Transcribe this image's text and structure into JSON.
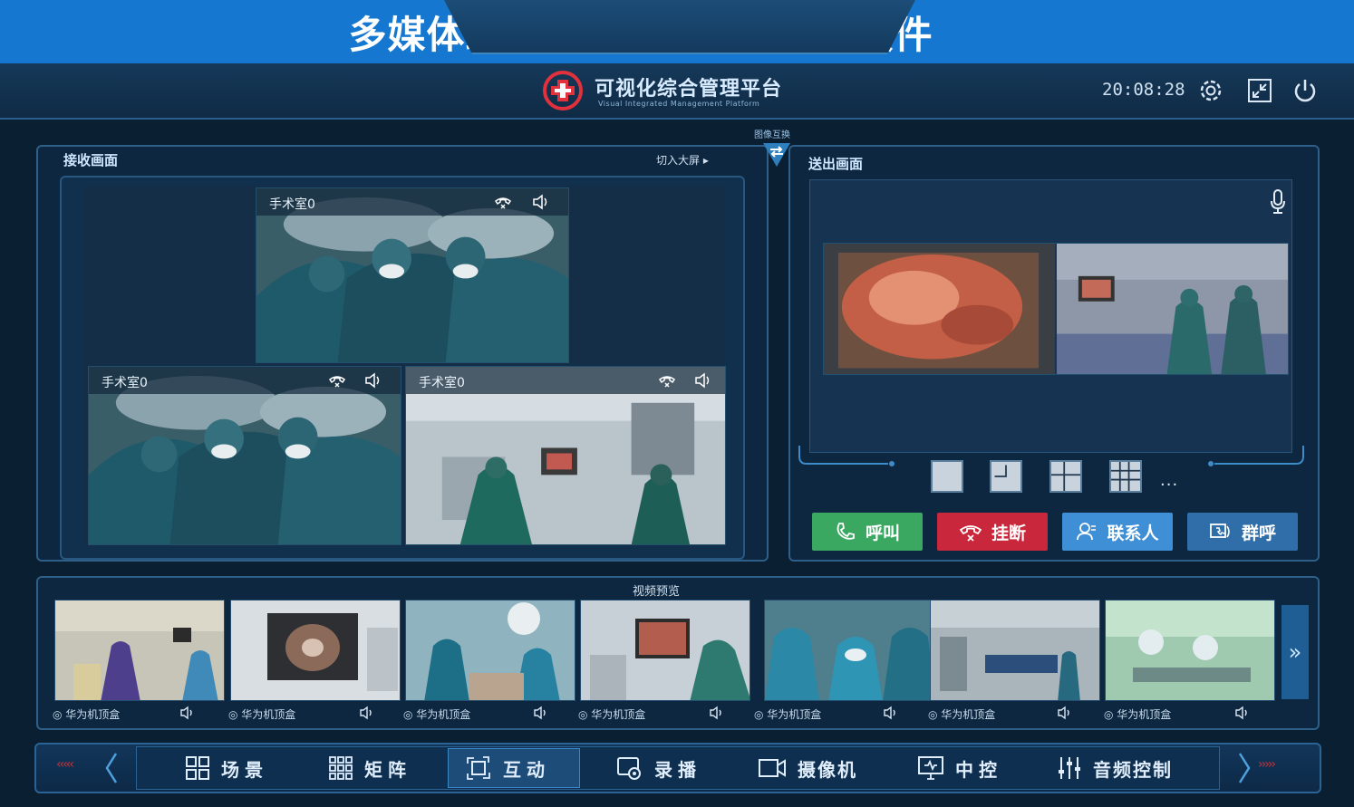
{
  "banner": {
    "title": "多媒体综合管理一体机—管理软件"
  },
  "header": {
    "platform_title": "可视化综合管理平台",
    "platform_subtitle": "Visual Integrated Management Platform",
    "time": "20:08:28",
    "icons": [
      "settings-icon",
      "exit-fullscreen-icon",
      "power-icon"
    ]
  },
  "receive": {
    "title": "接收画面",
    "big_screen": "切入大屏",
    "swap_label": "图像互换",
    "videos": [
      {
        "name": "手术室0"
      },
      {
        "name": "手术室0"
      },
      {
        "name": "手术室0"
      }
    ]
  },
  "send": {
    "title": "送出画面",
    "more": "...",
    "buttons": {
      "call": "呼叫",
      "hangup": "挂断",
      "contacts": "联系人",
      "group_call": "群呼"
    }
  },
  "preview": {
    "title": "视频预览",
    "items": [
      {
        "label": "华为机顶盒"
      },
      {
        "label": "华为机顶盒"
      },
      {
        "label": "华为机顶盒"
      },
      {
        "label": "华为机顶盒"
      },
      {
        "label": "华为机顶盒"
      },
      {
        "label": "华为机顶盒"
      },
      {
        "label": "华为机顶盒"
      }
    ]
  },
  "nav": {
    "items": [
      {
        "label": "场景",
        "icon": "grid-2x2-icon"
      },
      {
        "label": "矩阵",
        "icon": "grid-3x3-icon"
      },
      {
        "label": "互动",
        "icon": "interact-icon",
        "active": true
      },
      {
        "label": "录播",
        "icon": "record-icon"
      },
      {
        "label": "摄像机",
        "icon": "camera-icon"
      },
      {
        "label": "中控",
        "icon": "monitor-icon"
      },
      {
        "label": "音频控制",
        "icon": "equalizer-icon"
      }
    ]
  },
  "colors": {
    "banner": "#1577cf",
    "call_green": "#3aa860",
    "hangup_red": "#c9283c",
    "contacts_blue": "#3e8fd6",
    "group_blue": "#2f6ea8"
  }
}
